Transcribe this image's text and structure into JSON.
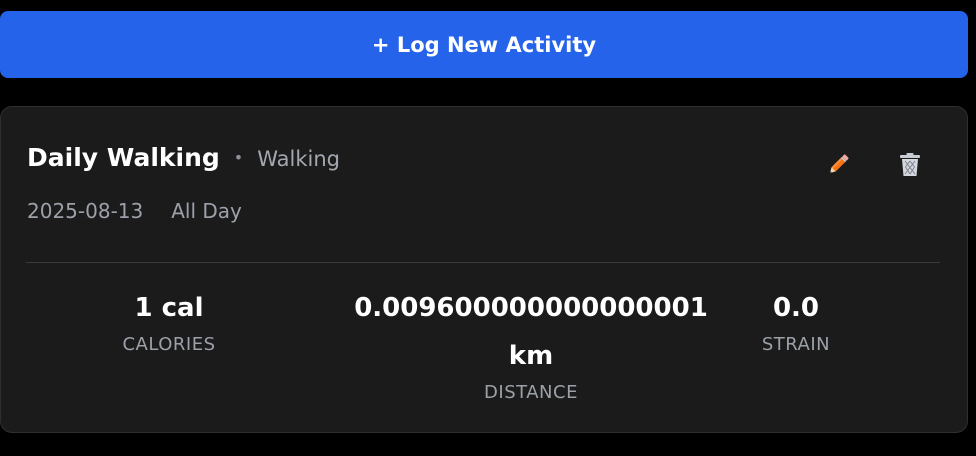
{
  "log_button": {
    "label": "+ Log New Activity"
  },
  "activity": {
    "title": "Daily Walking",
    "separator": "•",
    "type": "Walking",
    "date": "2025-08-13",
    "time": "All Day",
    "actions": {
      "edit_icon": "pencil-icon",
      "delete_icon": "trash-icon"
    },
    "stats": {
      "calories": {
        "value": "1 cal",
        "label": "CALORIES"
      },
      "distance": {
        "value_line1": "0.009600000000000001",
        "value_line2": "km",
        "label": "DISTANCE"
      },
      "strain": {
        "value": "0.0",
        "label": "STRAIN"
      }
    }
  },
  "colors": {
    "accent": "#2563eb",
    "background": "#000000",
    "card": "#1b1b1b",
    "edit_icon": "#f97316",
    "delete_icon": "#c8ccd2"
  }
}
